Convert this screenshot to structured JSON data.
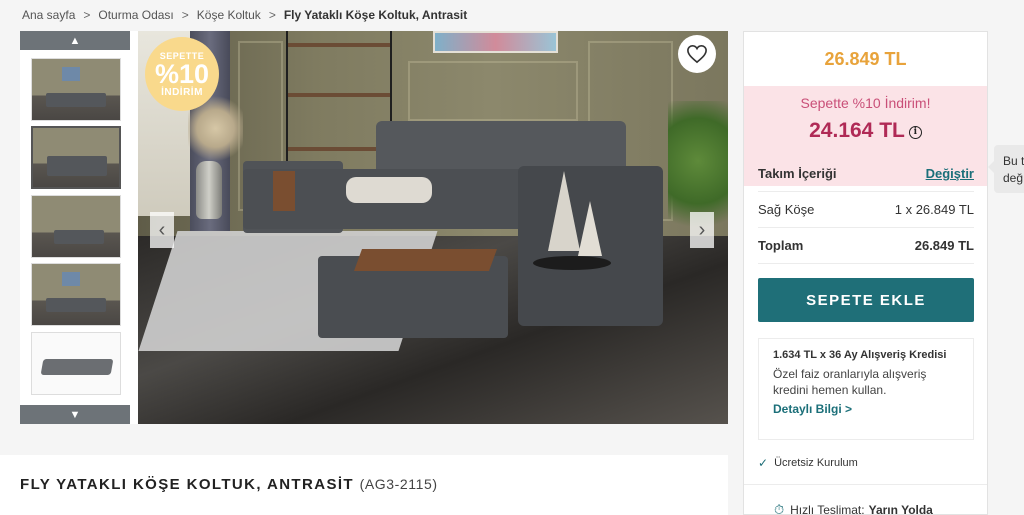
{
  "breadcrumb": {
    "items": [
      "Ana sayfa",
      "Oturma Odası",
      "Köşe Koltuk"
    ],
    "current": "Fly Yataklı Köşe Koltuk, Antrasit",
    "separator": ">"
  },
  "gallery": {
    "badge": {
      "top": "SEPETTE",
      "middle": "%10",
      "bottom": "İNDİRİM"
    },
    "arrow_up": "▲",
    "arrow_down": "▼",
    "prev": "‹",
    "next": "›"
  },
  "product": {
    "title": "FLY YATAKLI KÖŞE KOLTUK, ANTRASİT",
    "code": "(AG3-2115)"
  },
  "buybox": {
    "price_old": "26.849 TL",
    "promo_text": "Sepette %10 İndirim!",
    "price_new": "24.164 TL",
    "info_icon": "i",
    "set_label": "Takım İçeriği",
    "change_label": "Değiştir",
    "item_name": "Sağ Köşe",
    "item_value": "1 x 26.849 TL",
    "total_label": "Toplam",
    "total_value": "26.849 TL",
    "add_to_cart": "SEPETE EKLE",
    "credit": {
      "title": "1.634 TL x 36 Ay Alışveriş Kredisi",
      "desc": "Özel faiz oranlarıyla alışveriş kredini hemen kullan.",
      "link": "Detaylı Bilgi >"
    },
    "install": "Ücretsiz Kurulum",
    "delivery_label": "Hızlı Teslimat:",
    "delivery_value": "Yarın Yolda"
  },
  "tooltip_peek": {
    "line1": "Bu t",
    "line2": "değ"
  },
  "colors": {
    "accent_teal": "#1f6f78",
    "price_orange": "#e8a33b",
    "promo_pink": "#b02a56",
    "promo_bg": "#fbe3e7"
  },
  "icons": [
    "heart-icon",
    "chevron-up-icon",
    "chevron-down-icon",
    "chevron-left-icon",
    "chevron-right-icon",
    "info-icon",
    "check-icon",
    "truck-icon"
  ]
}
